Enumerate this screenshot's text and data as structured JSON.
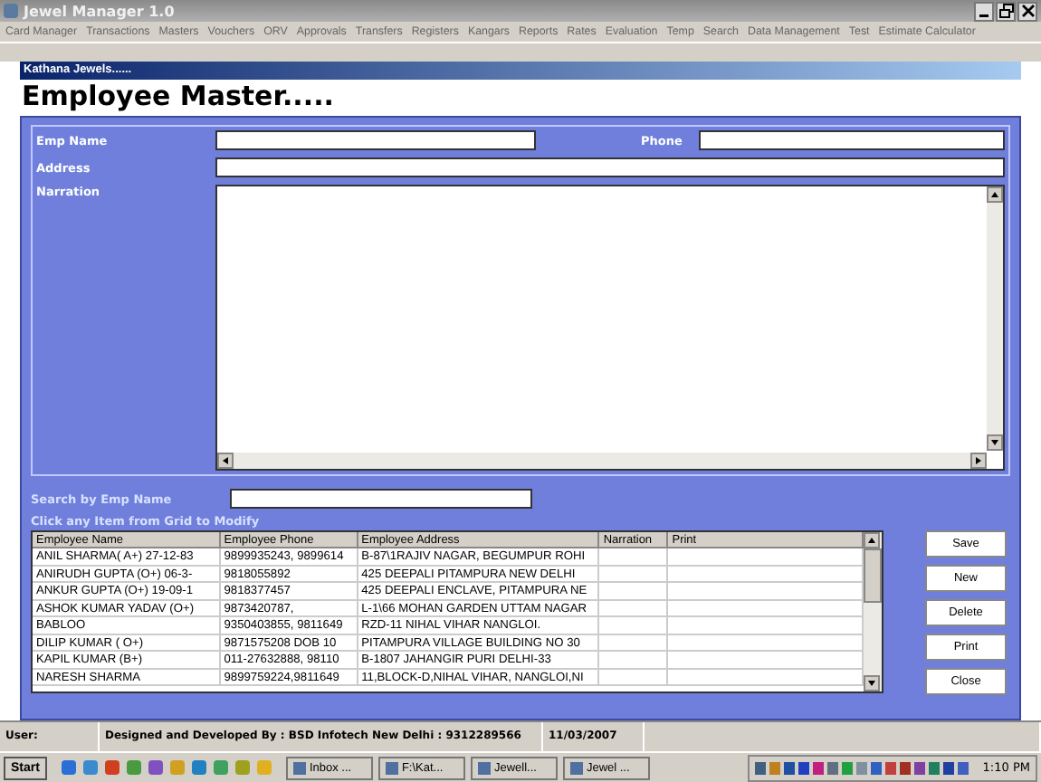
{
  "window": {
    "title": "Jewel Manager 1.0"
  },
  "menu": [
    "Card Manager",
    "Transactions",
    "Masters",
    "Vouchers",
    "ORV",
    "Approvals",
    "Transfers",
    "Registers",
    "Kangars",
    "Reports",
    "Rates",
    "Evaluation",
    "Temp",
    "Search",
    "Data Management",
    "Test",
    "Estimate Calculator"
  ],
  "child_window": {
    "caption": "Kathana Jewels......",
    "heading": "Employee Master....."
  },
  "form": {
    "emp_name_label": "Emp Name",
    "phone_label": "Phone",
    "address_label": "Address",
    "narration_label": "Narration",
    "search_label": "Search by Emp Name",
    "hint": "Click any Item from Grid to Modify"
  },
  "table": {
    "columns": [
      "Employee Name",
      "Employee Phone",
      "Employee Address",
      "Narration",
      "Print"
    ],
    "rows": [
      [
        "ANIL SHARMA(  A+)  27-12-83",
        "9899935243, 9899614",
        "B-87\\1RAJIV NAGAR, BEGUMPUR ROHI",
        "",
        ""
      ],
      [
        "ANIRUDH GUPTA  (O+)  06-3-",
        "9818055892",
        "425 DEEPALI PITAMPURA NEW DELHI",
        "",
        ""
      ],
      [
        "ANKUR GUPTA  (O+)  19-09-1",
        "9818377457",
        "425 DEEPALI ENCLAVE, PITAMPURA NE",
        "",
        ""
      ],
      [
        "ASHOK KUMAR YADAV  (O+)",
        "9873420787,",
        "L-1\\66 MOHAN GARDEN UTTAM NAGAR",
        "",
        ""
      ],
      [
        "BABLOO",
        "9350403855, 9811649",
        "RZD-11 NIHAL VIHAR NANGLOI.",
        "",
        ""
      ],
      [
        "DILIP KUMAR ( O+)",
        "9871575208  DOB  10",
        "PITAMPURA VILLAGE BUILDING NO 30",
        "",
        ""
      ],
      [
        "KAPIL KUMAR  (B+)",
        "011-27632888, 98110",
        "B-1807 JAHANGIR PURI DELHI-33",
        "",
        ""
      ],
      [
        "NARESH SHARMA",
        "9899759224,9811649",
        "11,BLOCK-D,NIHAL VIHAR, NANGLOI,NI",
        "",
        ""
      ]
    ]
  },
  "buttons": [
    "Save",
    "New",
    "Delete",
    "Print",
    "Close"
  ],
  "status_bar": [
    "User:",
    "Designed and Developed By : BSD Infotech New Delhi : 9312289566",
    "11/03/2007"
  ],
  "taskbar": {
    "start": "Start",
    "tasks": [
      "Inbox ...",
      "F:\\Kat...",
      "Jewell...",
      "Jewel ..."
    ],
    "clock": "1:10 PM"
  }
}
